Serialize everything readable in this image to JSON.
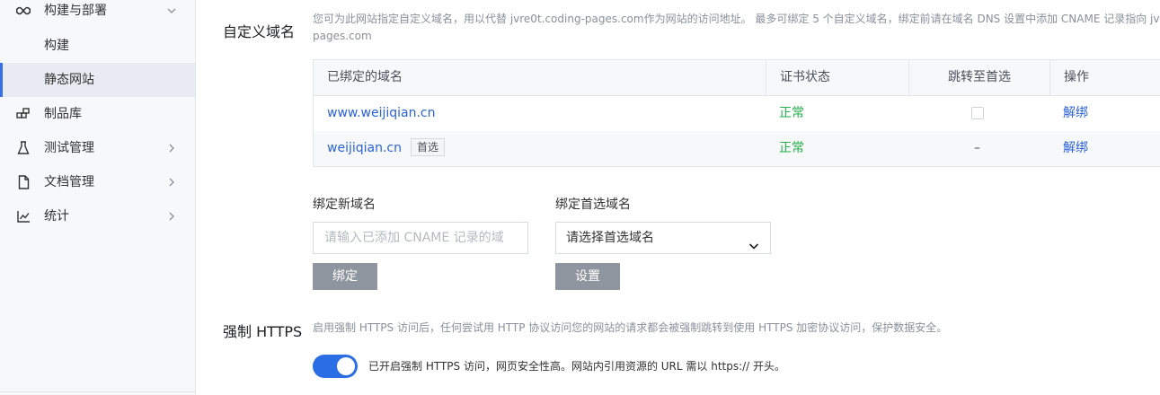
{
  "sidebar": {
    "items": [
      {
        "label": "构建与部署",
        "icon": "infinity-icon",
        "chevron": "chevron-down"
      },
      {
        "label": "构建"
      },
      {
        "label": "静态网站",
        "active": true
      },
      {
        "label": "制品库",
        "icon": "package-icon"
      },
      {
        "label": "测试管理",
        "icon": "flask-icon",
        "chevron": "chevron-right"
      },
      {
        "label": "文档管理",
        "icon": "document-icon",
        "chevron": "chevron-right"
      },
      {
        "label": "统计",
        "icon": "chart-icon",
        "chevron": "chevron-right"
      }
    ]
  },
  "domain_section": {
    "title": "自定义域名",
    "description_line1": "您可为此网站指定自定义域名，用以代替 jvre0t.coding-pages.com作为网站的访问地址。 最多可绑定 5 个自定义域名，绑定前请在域名 DNS 设置中添加 CNAME 记录指向 jvre",
    "description_line2": "pages.com",
    "table": {
      "headers": [
        "已绑定的域名",
        "证书状态",
        "跳转至首选",
        "操作"
      ],
      "rows": [
        {
          "domain": "www.weijiqian.cn",
          "status": "正常",
          "redirect": "checkbox",
          "action": "解绑"
        },
        {
          "domain": "weijiqian.cn",
          "tag": "首选",
          "status": "正常",
          "redirect": "–",
          "action": "解绑"
        }
      ]
    },
    "bind_new": {
      "label": "绑定新域名",
      "placeholder": "请输入已添加 CNAME 记录的域",
      "button": "绑定"
    },
    "bind_preferred": {
      "label": "绑定首选域名",
      "selected": "请选择首选域名",
      "button": "设置"
    }
  },
  "https_section": {
    "title": "强制 HTTPS",
    "description": "启用强制 HTTPS 访问后，任何尝试用 HTTP 协议访问您的网站的请求都会被强制跳转到使用 HTTPS 加密协议访问，保护数据安全。",
    "toggle_on": true,
    "toggle_text": "已开启强制 HTTPS 访问，网页安全性高。网站内引用资源的 URL 需以 https:// 开头。"
  },
  "colors": {
    "accent": "#3670e6",
    "link": "#2a62d9",
    "success": "#22b04a",
    "button_disabled": "#8f959e"
  }
}
